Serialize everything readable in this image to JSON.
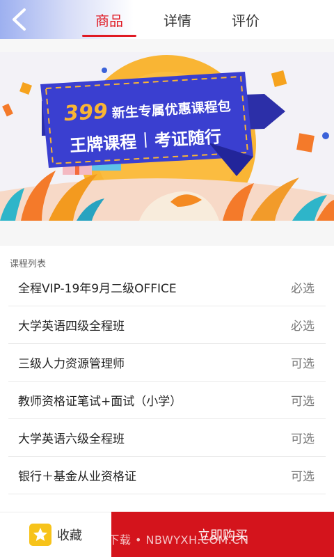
{
  "header": {
    "tabs": [
      {
        "label": "商品",
        "active": true
      },
      {
        "label": "详情",
        "active": false
      },
      {
        "label": "评价",
        "active": false
      }
    ]
  },
  "banner": {
    "price": "399",
    "headline": "新生专属优惠课程包",
    "subline_left": "王牌课程",
    "subline_right": "考证随行",
    "colors": {
      "sky": "#f1f1f6",
      "sun": "#f9b534",
      "board": "#3a3fd0",
      "ribbon": "#2c2fa8"
    }
  },
  "course_list": {
    "title": "课程列表",
    "items": [
      {
        "name": "全程VIP-19年9月二级OFFICE",
        "tag": "必选"
      },
      {
        "name": "大学英语四级全程班",
        "tag": "必选"
      },
      {
        "name": "三级人力资源管理师",
        "tag": "可选"
      },
      {
        "name": "教师资格证笔试+面试（小学）",
        "tag": "可选"
      },
      {
        "name": "大学英语六级全程班",
        "tag": "可选"
      },
      {
        "name": "银行＋基金从业资格证",
        "tag": "可选"
      }
    ]
  },
  "bottom_bar": {
    "favorite_label": "收藏",
    "favorite_icon": "star-icon",
    "buy_label": "立即购买",
    "buy_color": "#d4141c"
  },
  "watermark": "牛意下载 • NBWYXH.COM.CN"
}
